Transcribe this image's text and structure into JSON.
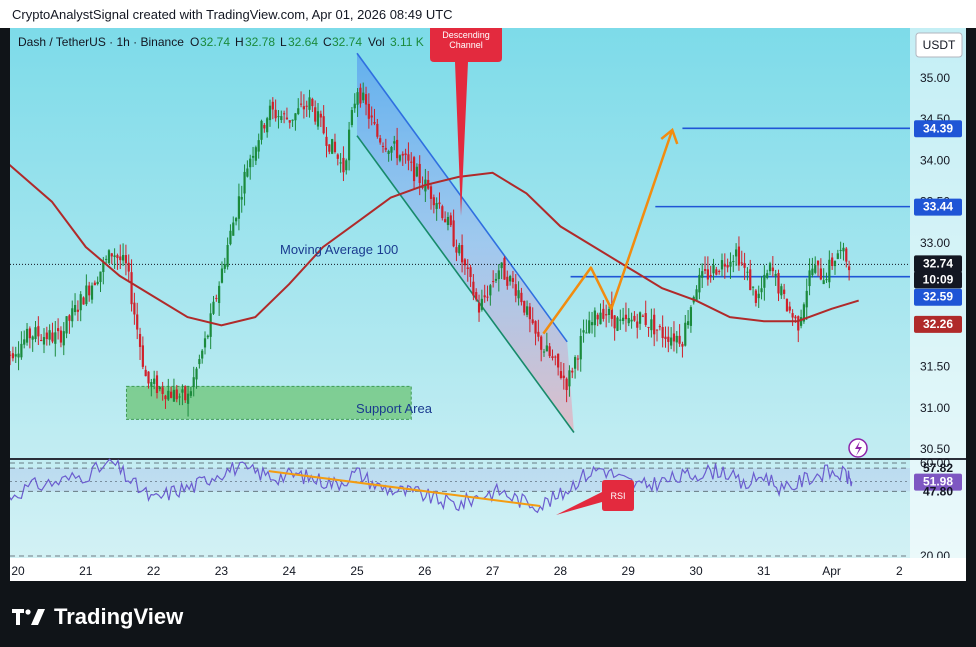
{
  "header": {
    "attribution": "CryptoAnalystSignal created with TradingView.com, Apr 01, 2026 08:49 UTC"
  },
  "legend": {
    "symbol": "Dash / TetherUS · 1h · Binance",
    "open_label": "O",
    "open": "32.74",
    "high_label": "H",
    "high": "32.78",
    "low_label": "L",
    "low": "32.64",
    "close_label": "C",
    "close": "32.74",
    "vol_label": "Vol",
    "vol": "3.11 K"
  },
  "currency_button": "USDT",
  "annotations": {
    "descending_channel_line1": "Descending",
    "descending_channel_line2": "Channel",
    "moving_average": "Moving Average 100",
    "support_area": "Support Area",
    "rsi_callout": "RSI"
  },
  "price_badges": {
    "target_high": "34.39",
    "target_mid": "33.44",
    "current_price": "32.74",
    "countdown": "10:09",
    "support_level": "32.59",
    "ma_value": "32.26"
  },
  "rsi_badges": {
    "upper": "57.82",
    "current": "51.98",
    "lower": "47.80"
  },
  "branding": {
    "name": "TradingView"
  },
  "colors": {
    "bg_top": "#8fe1ee",
    "bg_bottom": "#c6edf2",
    "bull": "#1b8a3c",
    "bear": "#d0202a",
    "ma": "#b02a2a",
    "level_line": "#1f55d6",
    "projection": "#f28c0f",
    "channel_fill": "#4a8cf0",
    "channel_fill_low": "#f09ba8",
    "support_fill": "#74c984",
    "rsi_line": "#6b5ccf",
    "rsi_trend": "#f39c12",
    "callout": "#e32a3e"
  },
  "chart_data": {
    "type": "candlestick",
    "title": "Dash / TetherUS · 1h · Binance",
    "x_ticks": [
      "20",
      "21",
      "22",
      "23",
      "24",
      "25",
      "26",
      "27",
      "28",
      "29",
      "30",
      "31",
      "Apr",
      "2"
    ],
    "y_ticks": [
      "35.00",
      "34.50",
      "34.00",
      "33.50",
      "33.00",
      "32.50",
      "32.00",
      "31.50",
      "31.00",
      "30.50"
    ],
    "ylim": [
      30.4,
      35.3
    ],
    "rsi_ticks": [
      "60.00",
      "20.00"
    ],
    "rsi_ylim": [
      15,
      65
    ],
    "levels": [
      34.39,
      33.44,
      32.59
    ],
    "ma_period": 100,
    "support_zone": [
      30.86,
      31.26
    ],
    "descending_channel": {
      "upper": [
        [
          25.0,
          35.3
        ],
        [
          28.1,
          31.8
        ]
      ],
      "lower": [
        [
          25.0,
          34.3
        ],
        [
          28.2,
          30.7
        ]
      ]
    },
    "projection_path": [
      [
        27.75,
        31.9
      ],
      [
        28.45,
        32.7
      ],
      [
        28.75,
        32.2
      ],
      [
        29.65,
        34.37
      ]
    ],
    "rsi_trendline": [
      [
        23.7,
        56.5
      ],
      [
        27.7,
        41.5
      ]
    ],
    "moving_average": [
      [
        19.8,
        34.0
      ],
      [
        20.5,
        33.5
      ],
      [
        21.0,
        32.95
      ],
      [
        21.5,
        32.6
      ],
      [
        22.0,
        32.35
      ],
      [
        22.5,
        32.1
      ],
      [
        23.0,
        32.0
      ],
      [
        23.5,
        32.1
      ],
      [
        24.0,
        32.5
      ],
      [
        24.5,
        32.95
      ],
      [
        25.0,
        33.25
      ],
      [
        25.5,
        33.55
      ],
      [
        26.0,
        33.7
      ],
      [
        26.5,
        33.8
      ],
      [
        27.0,
        33.85
      ],
      [
        27.5,
        33.6
      ],
      [
        28.0,
        33.2
      ],
      [
        28.5,
        32.95
      ],
      [
        29.0,
        32.7
      ],
      [
        29.5,
        32.45
      ],
      [
        30.0,
        32.3
      ],
      [
        30.5,
        32.1
      ],
      [
        31.0,
        32.05
      ],
      [
        31.5,
        32.05
      ],
      [
        32.0,
        32.2
      ],
      [
        32.4,
        32.3
      ]
    ],
    "price_path": [
      [
        19.8,
        31.6
      ],
      [
        20.2,
        31.9
      ],
      [
        20.6,
        31.85
      ],
      [
        21.0,
        32.4
      ],
      [
        21.4,
        32.9
      ],
      [
        21.6,
        32.7
      ],
      [
        21.9,
        31.3
      ],
      [
        22.2,
        31.2
      ],
      [
        22.5,
        31.1
      ],
      [
        22.8,
        31.9
      ],
      [
        23.1,
        33.0
      ],
      [
        23.4,
        34.0
      ],
      [
        23.7,
        34.6
      ],
      [
        24.0,
        34.5
      ],
      [
        24.3,
        34.7
      ],
      [
        24.6,
        34.2
      ],
      [
        24.8,
        33.9
      ],
      [
        25.0,
        34.9
      ],
      [
        25.3,
        34.3
      ],
      [
        25.6,
        34.1
      ],
      [
        25.9,
        33.8
      ],
      [
        26.2,
        33.5
      ],
      [
        26.5,
        32.9
      ],
      [
        26.8,
        32.2
      ],
      [
        27.1,
        32.7
      ],
      [
        27.4,
        32.4
      ],
      [
        27.6,
        31.9
      ],
      [
        27.9,
        31.55
      ],
      [
        28.1,
        31.3
      ],
      [
        28.3,
        31.8
      ],
      [
        28.6,
        32.2
      ],
      [
        28.9,
        32.0
      ],
      [
        29.2,
        32.1
      ],
      [
        29.5,
        31.9
      ],
      [
        29.8,
        31.85
      ],
      [
        30.0,
        32.5
      ],
      [
        30.3,
        32.7
      ],
      [
        30.6,
        32.9
      ],
      [
        30.9,
        32.3
      ],
      [
        31.1,
        32.7
      ],
      [
        31.3,
        32.3
      ],
      [
        31.5,
        32.0
      ],
      [
        31.7,
        32.7
      ],
      [
        31.9,
        32.6
      ],
      [
        32.1,
        32.9
      ],
      [
        32.3,
        32.74
      ]
    ],
    "rsi_path": [
      [
        19.8,
        45
      ],
      [
        20.2,
        50
      ],
      [
        20.6,
        52
      ],
      [
        21.0,
        55
      ],
      [
        21.4,
        60
      ],
      [
        21.7,
        51
      ],
      [
        22.0,
        44
      ],
      [
        22.3,
        48
      ],
      [
        22.6,
        50
      ],
      [
        22.9,
        55
      ],
      [
        23.2,
        58
      ],
      [
        23.5,
        56
      ],
      [
        23.8,
        54
      ],
      [
        24.1,
        55
      ],
      [
        24.4,
        53
      ],
      [
        24.7,
        51
      ],
      [
        25.0,
        56
      ],
      [
        25.3,
        50
      ],
      [
        25.6,
        48
      ],
      [
        25.9,
        47
      ],
      [
        26.2,
        44
      ],
      [
        26.5,
        42
      ],
      [
        26.8,
        46
      ],
      [
        27.1,
        48
      ],
      [
        27.4,
        44
      ],
      [
        27.7,
        42
      ],
      [
        28.0,
        46
      ],
      [
        28.3,
        54
      ],
      [
        28.6,
        58
      ],
      [
        28.9,
        53
      ],
      [
        29.2,
        50
      ],
      [
        29.5,
        52
      ],
      [
        29.8,
        54
      ],
      [
        30.1,
        56
      ],
      [
        30.4,
        57
      ],
      [
        30.7,
        50
      ],
      [
        31.0,
        55
      ],
      [
        31.3,
        48
      ],
      [
        31.6,
        53
      ],
      [
        31.9,
        56
      ],
      [
        32.2,
        55
      ],
      [
        32.3,
        52
      ]
    ]
  }
}
